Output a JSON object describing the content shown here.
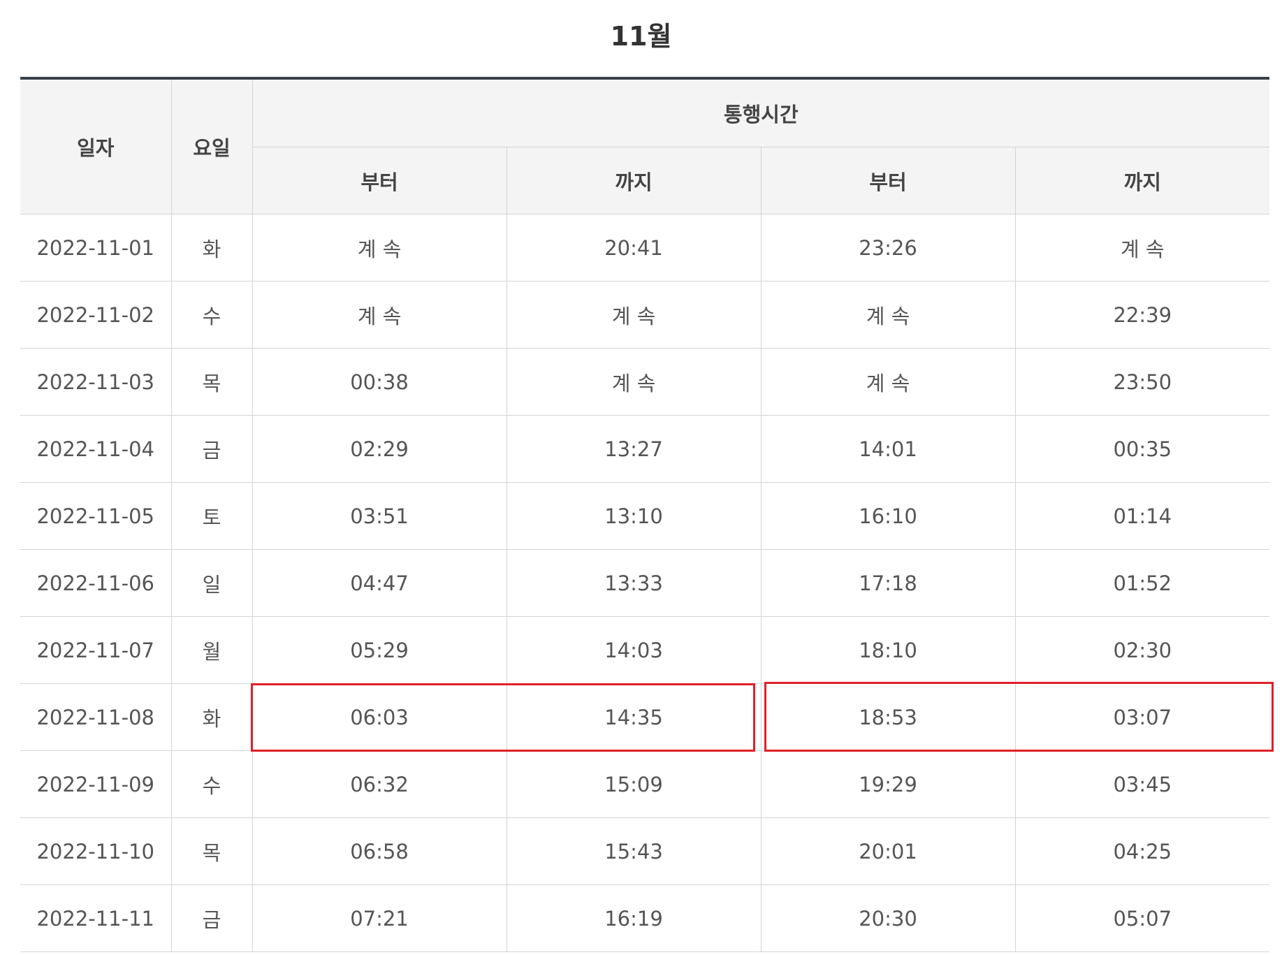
{
  "title": "11월",
  "header": {
    "date": "일자",
    "weekday": "요일",
    "passage_time": "통행시간",
    "from_1": "부터",
    "until_1": "까지",
    "from_2": "부터",
    "until_2": "까지"
  },
  "rows": [
    {
      "date": "2022-11-01",
      "day": "화",
      "from1": "계 속",
      "to1": "20:41",
      "from2": "23:26",
      "to2": "계 속"
    },
    {
      "date": "2022-11-02",
      "day": "수",
      "from1": "계 속",
      "to1": "계 속",
      "from2": "계 속",
      "to2": "22:39"
    },
    {
      "date": "2022-11-03",
      "day": "목",
      "from1": "00:38",
      "to1": "계 속",
      "from2": "계 속",
      "to2": "23:50"
    },
    {
      "date": "2022-11-04",
      "day": "금",
      "from1": "02:29",
      "to1": "13:27",
      "from2": "14:01",
      "to2": "00:35"
    },
    {
      "date": "2022-11-05",
      "day": "토",
      "from1": "03:51",
      "to1": "13:10",
      "from2": "16:10",
      "to2": "01:14"
    },
    {
      "date": "2022-11-06",
      "day": "일",
      "from1": "04:47",
      "to1": "13:33",
      "from2": "17:18",
      "to2": "01:52"
    },
    {
      "date": "2022-11-07",
      "day": "월",
      "from1": "05:29",
      "to1": "14:03",
      "from2": "18:10",
      "to2": "02:30"
    },
    {
      "date": "2022-11-08",
      "day": "화",
      "from1": "06:03",
      "to1": "14:35",
      "from2": "18:53",
      "to2": "03:07"
    },
    {
      "date": "2022-11-09",
      "day": "수",
      "from1": "06:32",
      "to1": "15:09",
      "from2": "19:29",
      "to2": "03:45"
    },
    {
      "date": "2022-11-10",
      "day": "목",
      "from1": "06:58",
      "to1": "15:43",
      "from2": "20:01",
      "to2": "04:25"
    },
    {
      "date": "2022-11-11",
      "day": "금",
      "from1": "07:21",
      "to1": "16:19",
      "from2": "20:30",
      "to2": "05:07"
    }
  ],
  "colors": {
    "header_bg": "#f4f4f4",
    "top_border": "#36404a",
    "highlight": "#e0202a"
  }
}
